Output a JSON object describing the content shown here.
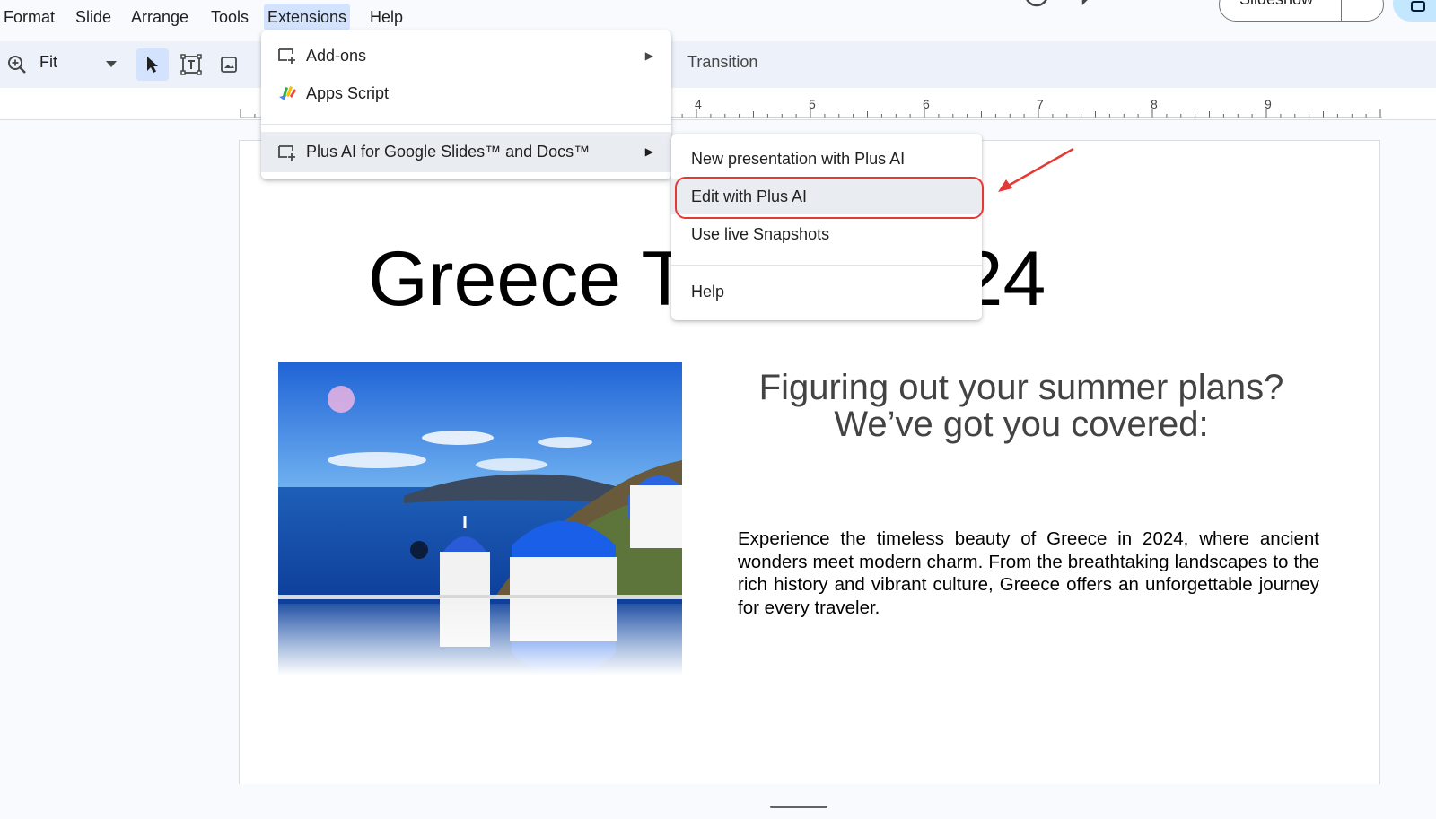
{
  "menubar": {
    "items": [
      "Format",
      "Slide",
      "Arrange",
      "Tools",
      "Extensions",
      "Help"
    ],
    "active": "Extensions"
  },
  "header": {
    "slideshow_label": "Slideshow"
  },
  "toolbar": {
    "zoom_value": "Fit",
    "transition_label": "Transition"
  },
  "ruler": {
    "marks": [
      "4",
      "5",
      "6",
      "7",
      "8",
      "9"
    ]
  },
  "extensions_menu": {
    "items": [
      {
        "label": "Add-ons",
        "icon": "addon-icon",
        "has_submenu": true
      },
      {
        "label": "Apps Script",
        "icon": "apps-script-icon",
        "has_submenu": false
      },
      {
        "label": "Plus AI for Google Slides™ and Docs™",
        "icon": "addon-icon",
        "has_submenu": true
      }
    ]
  },
  "plus_ai_submenu": {
    "items": [
      {
        "label": "New presentation with Plus AI"
      },
      {
        "label": "Edit with Plus AI",
        "highlighted": true
      },
      {
        "label": "Use live Snapshots"
      },
      {
        "label": "Help"
      }
    ]
  },
  "slide": {
    "title": "Greece Travel 2024",
    "subtitle": "Figuring out your summer plans? We’ve got you covered:",
    "body": "Experience the timeless beauty of Greece in 2024, where ancient wonders meet modern charm. From the breathtaking landscapes to the rich history and vibrant culture, Greece offers an unforgettable journey for every traveler."
  },
  "colors": {
    "accent_blue": "#d3e3fd",
    "highlight_red": "#e53935"
  }
}
